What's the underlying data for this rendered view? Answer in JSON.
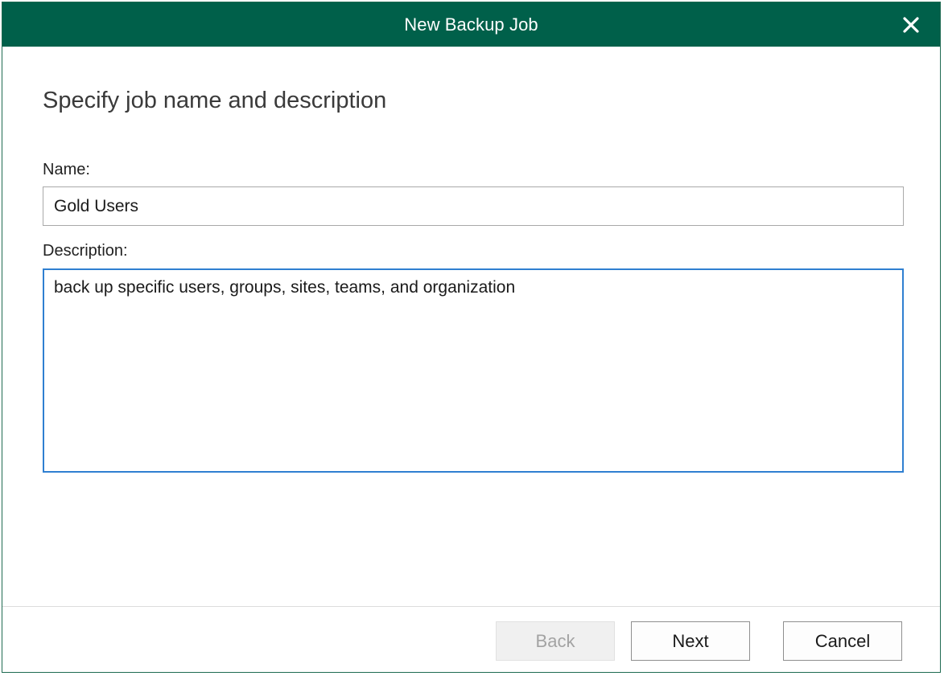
{
  "window": {
    "title": "New Backup Job",
    "close_icon": "close-icon"
  },
  "main": {
    "heading": "Specify job name and description",
    "name_label": "Name:",
    "name_value": "Gold Users",
    "description_label": "Description:",
    "description_value": "back up specific users, groups, sites, teams, and organization"
  },
  "footer": {
    "back_label": "Back",
    "back_enabled": false,
    "next_label": "Next",
    "cancel_label": "Cancel"
  },
  "colors": {
    "titlebar": "#00604a",
    "focus_border": "#2f7fd1"
  }
}
